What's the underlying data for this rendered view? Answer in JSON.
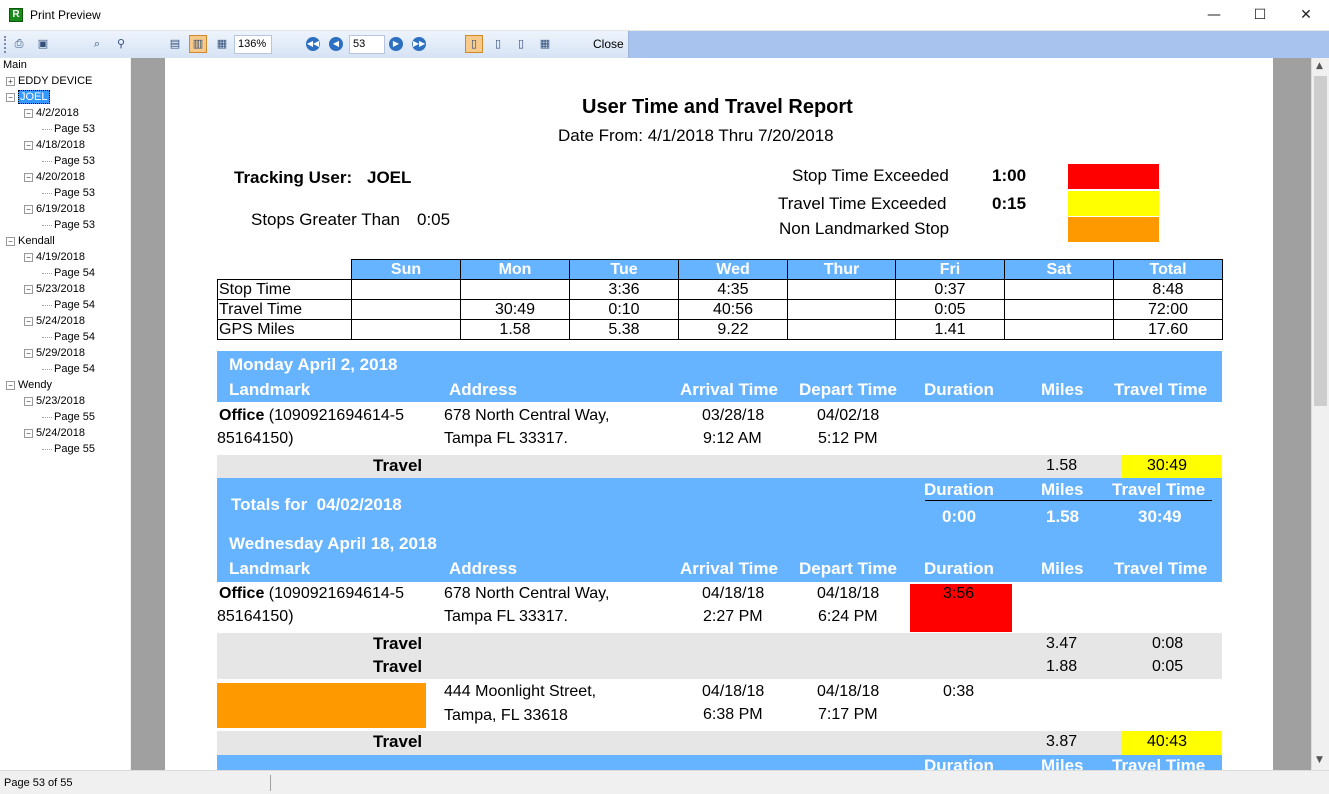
{
  "window": {
    "title": "Print Preview",
    "minimize": "—",
    "maximize": "☐",
    "close": "✕"
  },
  "toolbar": {
    "zoom": "136%",
    "page_number": "53",
    "close_label": "Close"
  },
  "tree": {
    "root": "Main",
    "nodes": [
      {
        "label": "EDDY DEVICE",
        "level": 1,
        "expand": "+"
      },
      {
        "label": "JOEL",
        "level": 1,
        "expand": "−",
        "selected": true
      },
      {
        "label": "4/2/2018",
        "level": 2,
        "expand": "−"
      },
      {
        "label": "Page 53",
        "level": 3
      },
      {
        "label": "4/18/2018",
        "level": 2,
        "expand": "−"
      },
      {
        "label": "Page 53",
        "level": 3
      },
      {
        "label": "4/20/2018",
        "level": 2,
        "expand": "−"
      },
      {
        "label": "Page 53",
        "level": 3
      },
      {
        "label": "6/19/2018",
        "level": 2,
        "expand": "−"
      },
      {
        "label": "Page 53",
        "level": 3
      },
      {
        "label": "Kendall",
        "level": 1,
        "expand": "−"
      },
      {
        "label": "4/19/2018",
        "level": 2,
        "expand": "−"
      },
      {
        "label": "Page 54",
        "level": 3
      },
      {
        "label": "5/23/2018",
        "level": 2,
        "expand": "−"
      },
      {
        "label": "Page 54",
        "level": 3
      },
      {
        "label": "5/24/2018",
        "level": 2,
        "expand": "−"
      },
      {
        "label": "Page 54",
        "level": 3
      },
      {
        "label": "5/29/2018",
        "level": 2,
        "expand": "−"
      },
      {
        "label": "Page 54",
        "level": 3
      },
      {
        "label": "Wendy",
        "level": 1,
        "expand": "−"
      },
      {
        "label": "5/23/2018",
        "level": 2,
        "expand": "−"
      },
      {
        "label": "Page 55",
        "level": 3
      },
      {
        "label": "5/24/2018",
        "level": 2,
        "expand": "−"
      },
      {
        "label": "Page 55",
        "level": 3
      }
    ]
  },
  "status": {
    "text": "Page 53 of 55"
  },
  "report": {
    "title": "User Time and Travel Report",
    "date_range": "Date From: 4/1/2018 Thru 7/20/2018",
    "tracking_user_label": "Tracking User:",
    "tracking_user": "JOEL",
    "stops_label": "Stops Greater Than",
    "stops_value": "0:05",
    "legend": [
      {
        "label": "Stop Time Exceeded",
        "value": "1:00",
        "color": "#ff0000"
      },
      {
        "label": "Travel Time Exceeded",
        "value": "0:15",
        "color": "#ffff00"
      },
      {
        "label": "Non Landmarked Stop",
        "value": "",
        "color": "#ff9900"
      }
    ],
    "week_table": {
      "headers": [
        "Sun",
        "Mon",
        "Tue",
        "Wed",
        "Thur",
        "Fri",
        "Sat",
        "Total"
      ],
      "rows": [
        {
          "label": "Stop Time",
          "values": [
            "",
            "",
            "3:36",
            "4:35",
            "",
            "0:37",
            "",
            "8:48"
          ]
        },
        {
          "label": "Travel Time",
          "values": [
            "",
            "30:49",
            "0:10",
            "40:56",
            "",
            "0:05",
            "",
            "72:00"
          ]
        },
        {
          "label": "GPS Miles",
          "values": [
            "",
            "1.58",
            "5.38",
            "9.22",
            "",
            "1.41",
            "",
            "17.60"
          ]
        }
      ]
    },
    "columns": {
      "landmark": "Landmark",
      "address": "Address",
      "arrival": "Arrival Time",
      "depart": "Depart Time",
      "duration": "Duration",
      "miles": "Miles",
      "travel_time": "Travel Time"
    },
    "day1": {
      "heading": "Monday April 2, 2018",
      "stop": {
        "landmark_bold": "Office",
        "landmark_rest": "(1090921694614-5",
        "landmark_line2": "85164150)",
        "address1": "678 North Central Way,",
        "address2": "Tampa FL 33317.",
        "arrival_date": "03/28/18",
        "arrival_time": "9:12 AM",
        "depart_date": "04/02/18",
        "depart_time": "5:12 PM"
      },
      "travel": {
        "label": "Travel",
        "miles": "1.58",
        "time": "30:49"
      },
      "totals_label": "Totals for",
      "totals_date": "04/02/2018",
      "totals": {
        "duration": "0:00",
        "miles": "1.58",
        "travel_time": "30:49"
      }
    },
    "day2": {
      "heading": "Wednesday April 18, 2018",
      "stop1": {
        "landmark_bold": "Office",
        "landmark_rest": "(1090921694614-5",
        "landmark_line2": "85164150)",
        "address1": "678 North Central Way,",
        "address2": "Tampa FL 33317.",
        "arrival_date": "04/18/18",
        "arrival_time": "2:27 PM",
        "depart_date": "04/18/18",
        "depart_time": "6:24 PM",
        "duration": "3:56"
      },
      "travel1": {
        "label": "Travel",
        "miles": "3.47",
        "time": "0:08"
      },
      "travel2": {
        "label": "Travel",
        "miles": "1.88",
        "time": "0:05"
      },
      "stop2": {
        "address1": "444 Moonlight Street,",
        "address2": "Tampa, FL 33618",
        "arrival_date": "04/18/18",
        "arrival_time": "6:38 PM",
        "depart_date": "04/18/18",
        "depart_time": "7:17 PM",
        "duration": "0:38"
      },
      "travel3": {
        "label": "Travel",
        "miles": "3.87",
        "time": "40:43"
      }
    }
  }
}
